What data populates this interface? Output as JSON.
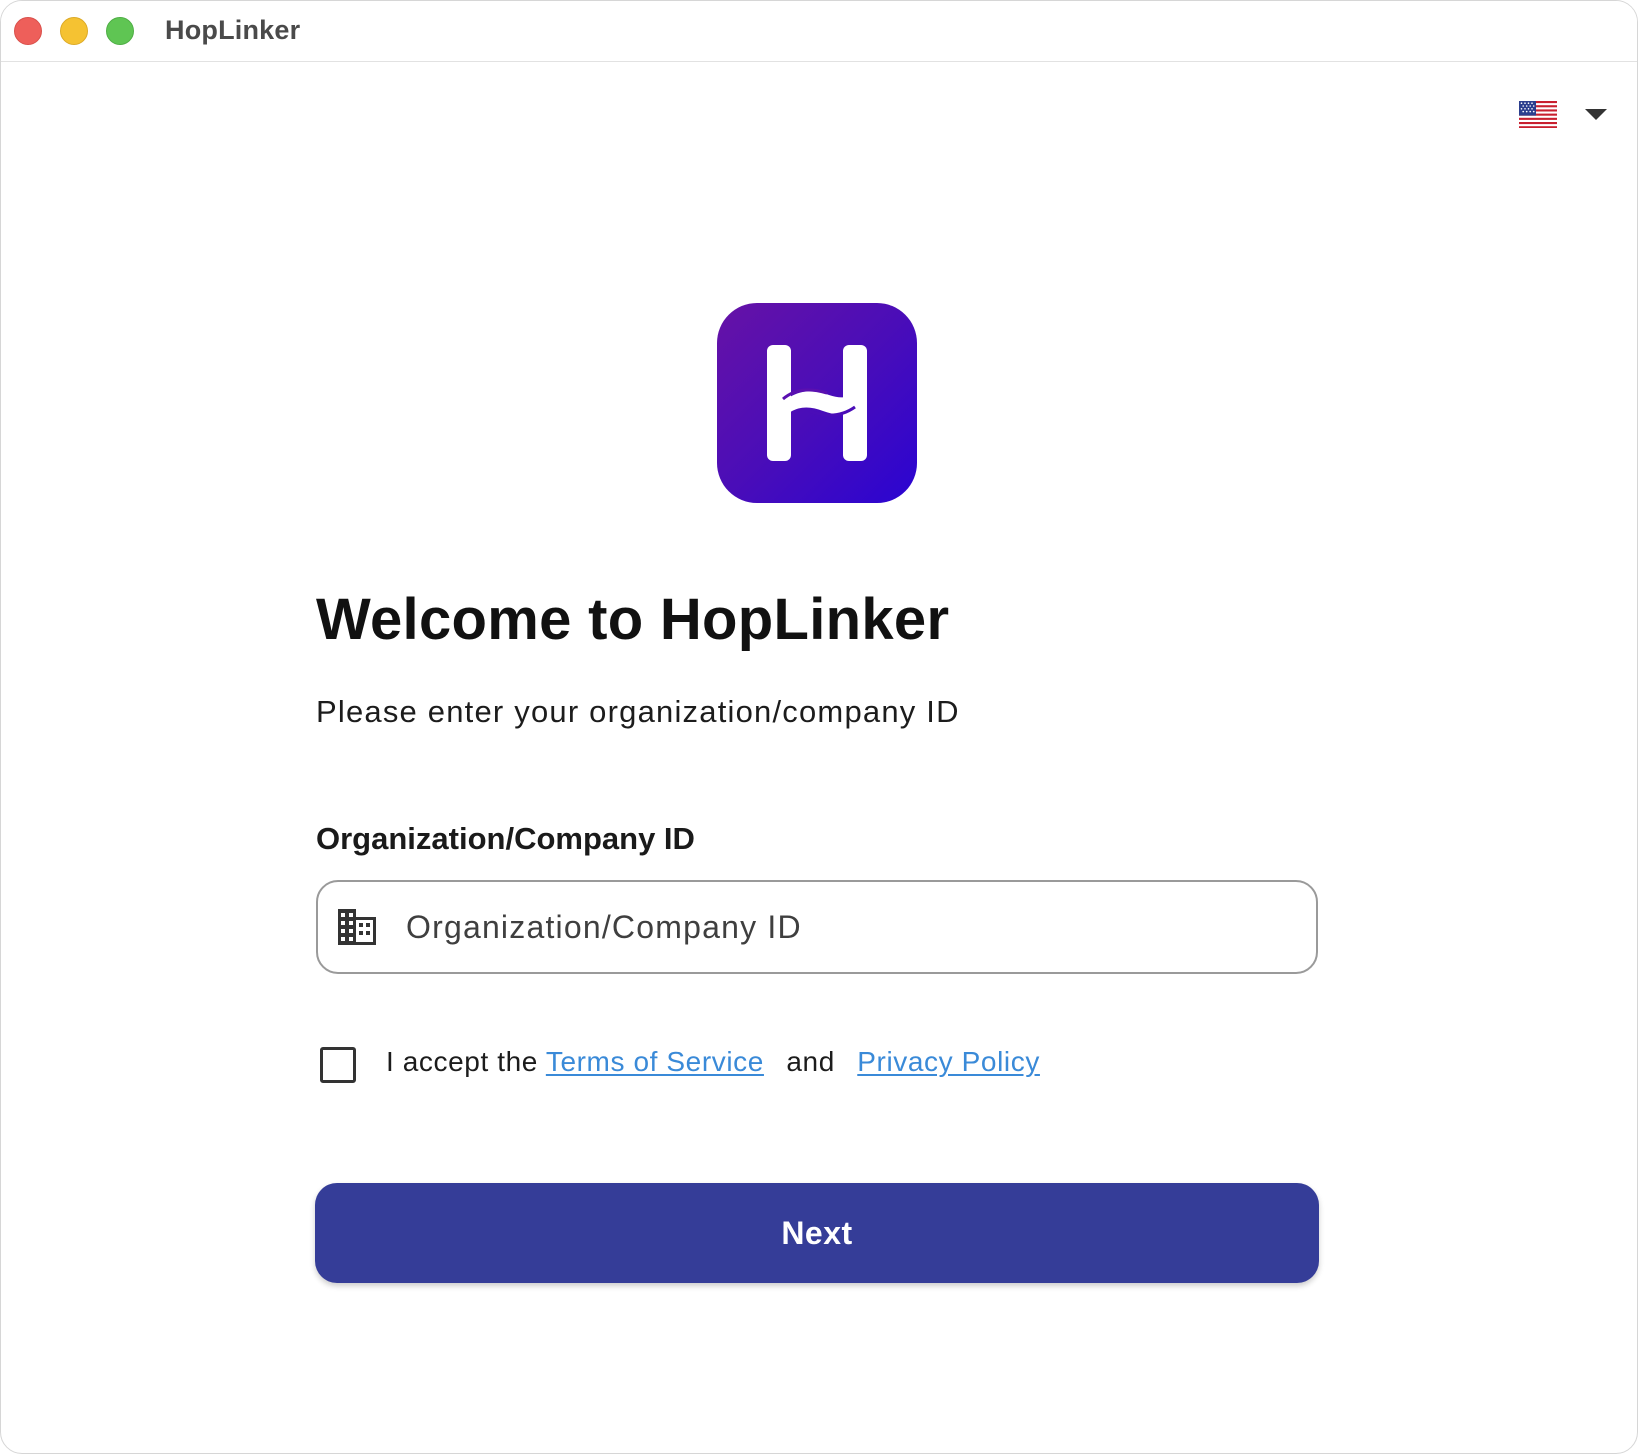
{
  "window": {
    "title": "HopLinker"
  },
  "language": {
    "flag_icon": "us-flag-icon",
    "dropdown_icon": "caret-down-icon"
  },
  "logo": {
    "icon": "hoplinker-logo-icon",
    "gradient": [
      "#6612a6",
      "#2a04d2"
    ]
  },
  "welcome": {
    "heading": "Welcome to HopLinker",
    "subtitle": "Please enter your organization/company ID"
  },
  "org_field": {
    "label": "Organization/Company ID",
    "placeholder": "Organization/Company ID",
    "value": "",
    "icon": "building-icon"
  },
  "terms": {
    "checked": false,
    "prefix": "I accept the",
    "tos_link": "Terms of Service",
    "conjunction": "and",
    "privacy_link": "Privacy Policy",
    "link_color": "#3a8ad8"
  },
  "next_button": {
    "label": "Next",
    "color": "#353d98"
  }
}
